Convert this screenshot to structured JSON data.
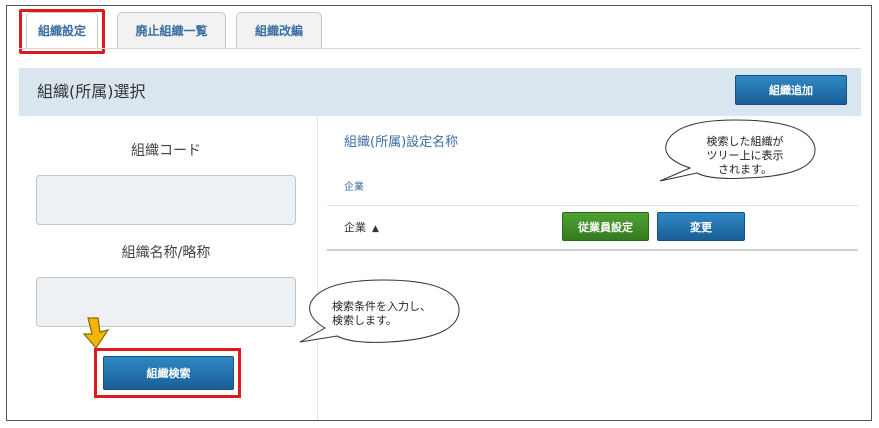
{
  "tabs": [
    {
      "label": "組織設定",
      "active": true
    },
    {
      "label": "廃止組織一覧",
      "active": false
    },
    {
      "label": "組織改編",
      "active": false
    }
  ],
  "header": {
    "title": "組織(所属)選択",
    "add_button_label": "組織追加"
  },
  "search_panel": {
    "code_label": "組織コード",
    "code_value": "",
    "name_label": "組織名称/略称",
    "name_value": "",
    "search_button_label": "組織検索"
  },
  "tree_panel": {
    "section_title": "組織(所属)設定名称",
    "breadcrumb_company": "企業",
    "row_label": "企業",
    "row_arrow": "▲",
    "employee_settings_label": "従業員設定",
    "change_label": "変更"
  },
  "callouts": {
    "tree_note": [
      "検索した組織が",
      "ツリー上に表示",
      "されます。"
    ],
    "search_note": [
      "検索条件を入力し、",
      "検索します。"
    ]
  },
  "colors": {
    "highlight_red": "#e0191e",
    "button_blue": "#1f6fad",
    "button_green": "#3f8f2a",
    "header_bg": "#d9e6ef",
    "arrow_yellow": "#f5b400"
  }
}
